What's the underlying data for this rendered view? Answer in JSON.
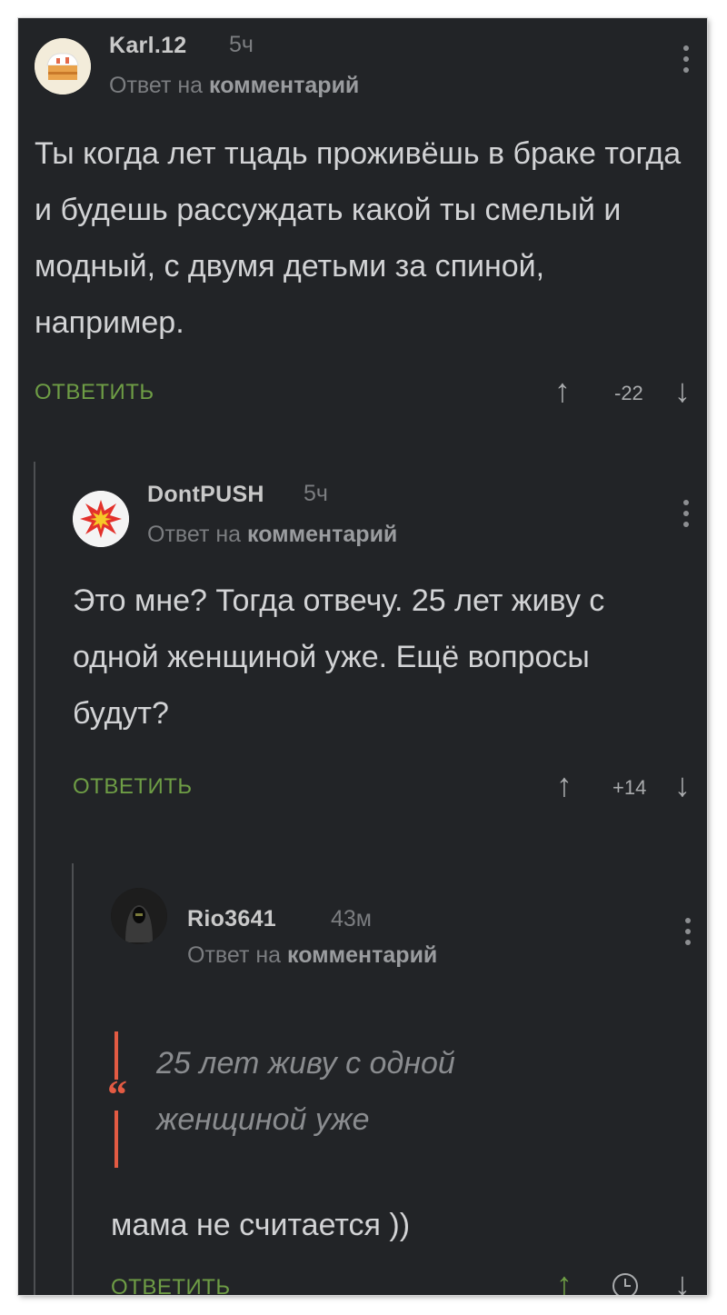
{
  "comments": [
    {
      "username": "Karl.12",
      "time": "5ч",
      "reply_prefix": "Ответ на",
      "reply_target": "комментарий",
      "body": "Ты когда лет тцадь проживёшь в браке тогда и будешь рассуждать какой ты смелый и модный, с двумя детьми за спиной, например.",
      "reply_label": "ОТВЕТИТЬ",
      "rating": "-22",
      "avatar": "cake-avatar"
    },
    {
      "username": "DontPUSH",
      "time": "5ч",
      "reply_prefix": "Ответ на",
      "reply_target": "комментарий",
      "body": "Это мне? Тогда отвечу. 25 лет живу с одной женщиной уже. Ещё вопросы будут?",
      "reply_label": "ОТВЕТИТЬ",
      "rating": "+14",
      "avatar": "explosion-avatar"
    },
    {
      "username": "Rio3641",
      "time": "43м",
      "reply_prefix": "Ответ на",
      "reply_target": "комментарий",
      "quote": "25 лет живу с одной женщиной уже",
      "quote_mark": "“",
      "body": "мама не считается ))",
      "reply_label": "ОТВЕТИТЬ",
      "avatar": "hooded-figure-avatar"
    }
  ],
  "colors": {
    "background": "#222427",
    "reply_green": "#6e9d45",
    "quote_red": "#e35b43"
  }
}
